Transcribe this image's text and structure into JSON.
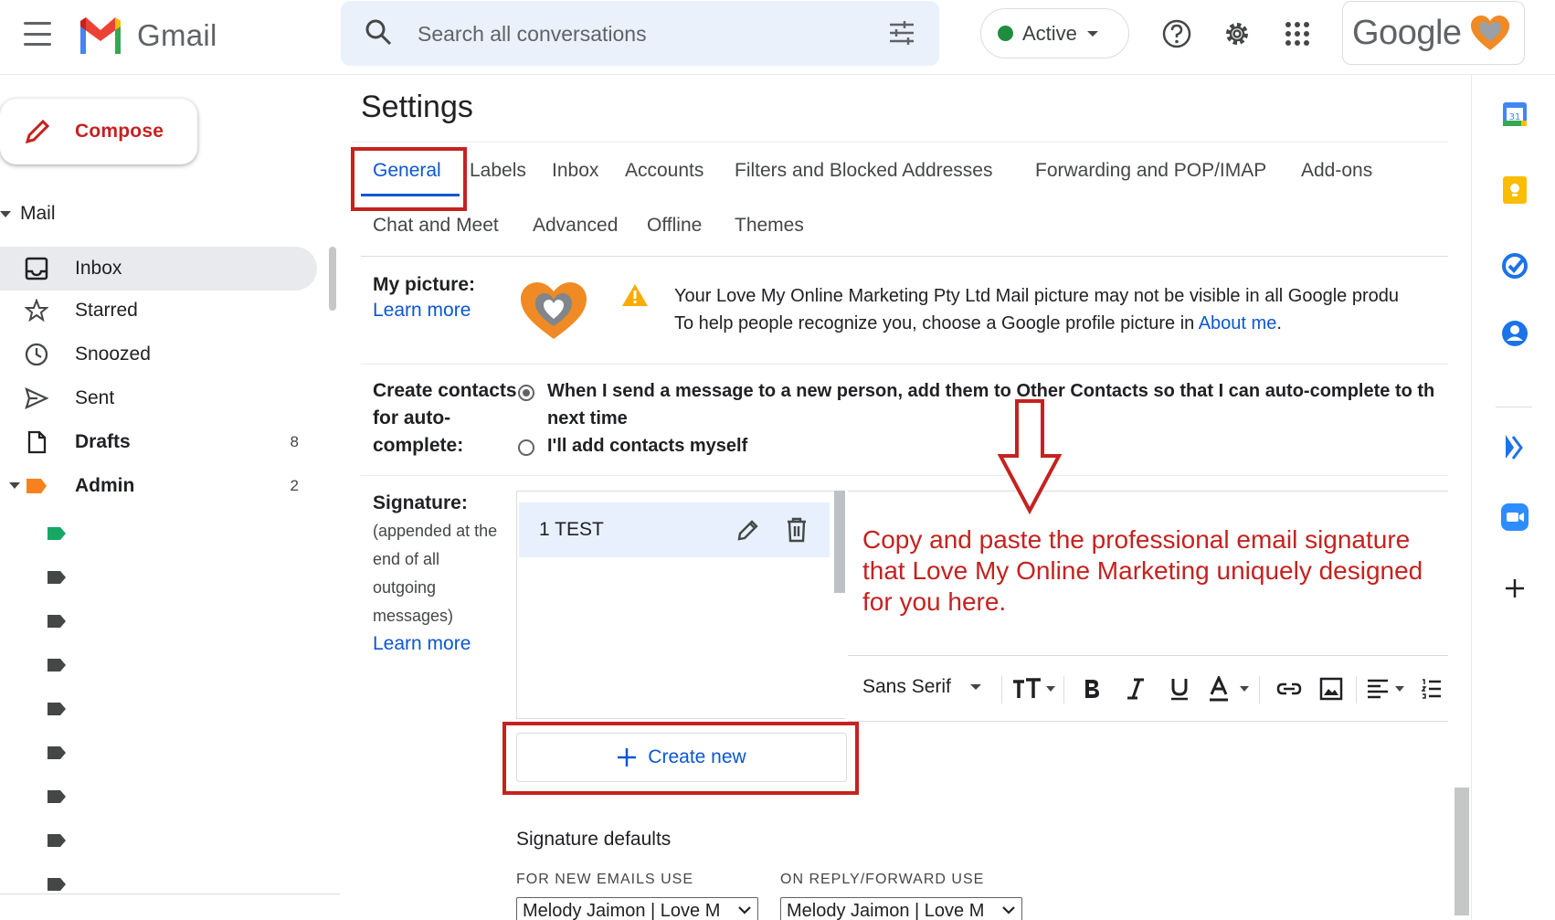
{
  "header": {
    "app_name": "Gmail",
    "search_placeholder": "Search all conversations",
    "status_label": "Active",
    "account_wordmark": "Google"
  },
  "compose": {
    "label": "Compose"
  },
  "nav": {
    "section_label": "Mail",
    "items": [
      {
        "label": "Inbox",
        "count": "",
        "bold": false,
        "selected": true,
        "icon": "inbox-icon"
      },
      {
        "label": "Starred",
        "count": "",
        "bold": false,
        "icon": "star-icon"
      },
      {
        "label": "Snoozed",
        "count": "",
        "bold": false,
        "icon": "clock-icon"
      },
      {
        "label": "Sent",
        "count": "",
        "bold": false,
        "icon": "send-icon"
      },
      {
        "label": "Drafts",
        "count": "8",
        "bold": true,
        "icon": "draft-icon"
      },
      {
        "label": "Admin",
        "count": "2",
        "bold": true,
        "icon": "label-icon"
      }
    ],
    "label_tag_colors": [
      "#16a765",
      "#444746",
      "#444746",
      "#444746",
      "#444746",
      "#444746",
      "#444746",
      "#444746",
      "#444746"
    ]
  },
  "settings": {
    "title": "Settings",
    "tabs_row1": [
      "General",
      "Labels",
      "Inbox",
      "Accounts",
      "Filters and Blocked Addresses",
      "Forwarding and POP/IMAP",
      "Add-ons"
    ],
    "tabs_row2": [
      "Chat and Meet",
      "Advanced",
      "Offline",
      "Themes"
    ],
    "active_tab": "General",
    "my_picture": {
      "label": "My picture:",
      "learn_more": "Learn more",
      "line1": "Your Love My Online Marketing Pty Ltd Mail picture may not be visible in all Google produ",
      "line2_prefix": "To help people recognize you, choose a Google profile picture in ",
      "line2_link": "About me",
      "line2_suffix": "."
    },
    "create_contacts": {
      "label_lines": [
        "Create contacts",
        "for auto-",
        "complete:"
      ],
      "option1_lines": [
        "When I send a message to a new person, add them to Other Contacts so that I can auto-complete to th",
        "next time"
      ],
      "option2": "I'll add contacts myself",
      "selected_option": 1
    },
    "signature": {
      "label": "Signature:",
      "sub_lines": [
        "(appended at the",
        "end of all",
        "outgoing",
        "messages)"
      ],
      "learn_more": "Learn more",
      "list_item": "1 TEST",
      "editor_text": "Copy and paste the professional email signature that Love My Online Marketing uniquely designed for you here.",
      "font_name": "Sans Serif",
      "create_new": "Create new"
    },
    "signature_defaults": {
      "title": "Signature defaults",
      "new_emails_caption": "FOR NEW EMAILS USE",
      "reply_caption": "ON REPLY/FORWARD USE",
      "new_emails_value": "Melody Jaimon | Love M",
      "reply_value": "Melody Jaimon | Love M"
    }
  },
  "colors": {
    "accent_blue": "#0b57d0",
    "annotation_red": "#c5221f",
    "status_green": "#1e8e3e"
  }
}
